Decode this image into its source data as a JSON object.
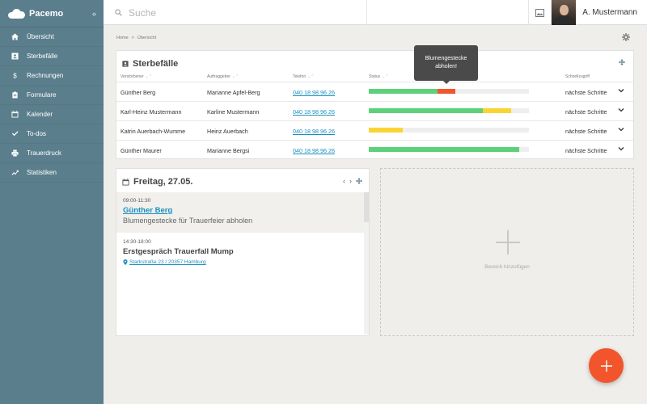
{
  "app": {
    "name": "Pacemo",
    "collapse_icon": "‹›"
  },
  "sidebar": {
    "items": [
      {
        "label": "Übersicht",
        "icon": "home-icon"
      },
      {
        "label": "Sterbefälle",
        "icon": "contact-card-icon"
      },
      {
        "label": "Rechnungen",
        "icon": "dollar-icon"
      },
      {
        "label": "Formulare",
        "icon": "clipboard-icon"
      },
      {
        "label": "Kalender",
        "icon": "calendar-icon"
      },
      {
        "label": "To-dos",
        "icon": "check-icon"
      },
      {
        "label": "Trauerdruck",
        "icon": "printer-icon"
      },
      {
        "label": "Statistiken",
        "icon": "trend-icon"
      }
    ]
  },
  "header": {
    "search_placeholder": "Suche",
    "user_name": "A. Mustermann"
  },
  "breadcrumb": {
    "home": "Home",
    "separator": ">",
    "current": "Übersicht"
  },
  "deaths": {
    "title": "Sterbefälle",
    "columns": {
      "deceased": "Verstorbener",
      "client": "Auftraggeber",
      "phone": "Telefon",
      "status": "Status",
      "quick": "Schnellzugriff"
    },
    "sort_mark": "⌄⌃",
    "rows": [
      {
        "deceased": "Günther Berg",
        "client": "Marianne Apfel-Berg",
        "phone": "040 18 98 96 26",
        "status_green": 0.43,
        "status_yellow": 0,
        "status_red": 0.11,
        "quick": "nächste Schritte"
      },
      {
        "deceased": "Karl-Heinz Mustermann",
        "client": "Karline Mustermann",
        "phone": "040 18 98 96 26",
        "status_green": 0.71,
        "status_yellow": 0.18,
        "status_red": 0,
        "quick": "nächste Schritte"
      },
      {
        "deceased": "Katrin Auerbach-Wumme",
        "client": "Heinz Auerbach",
        "phone": "040 18 98 96 26",
        "status_green": 0,
        "status_yellow": 0.21,
        "status_red": 0,
        "quick": "nächste Schritte"
      },
      {
        "deceased": "Günther Maurer",
        "client": "Marianne Bergsi",
        "phone": "040 18 98 96 26",
        "status_green": 0.94,
        "status_yellow": 0,
        "status_red": 0,
        "quick": "nächste Schritte"
      }
    ],
    "tooltip": {
      "line1": "Blumengestecke",
      "line2": "abholen!"
    },
    "colors": {
      "green": "#5ed07a",
      "yellow": "#fad434",
      "red": "#f2552c"
    }
  },
  "calendar": {
    "title": "Freitag, 27.05.",
    "prev": "‹",
    "next": "›",
    "events": [
      {
        "time": "09:00-11:30",
        "name": "Günther Berg",
        "detail": "Blumengestecke für Trauerfeier abholen"
      },
      {
        "time": "14:30-18:00",
        "name": "Erstgespräch Trauerfall Mump",
        "address": "Starkstraße 23 / 20357 Hamburg"
      }
    ]
  },
  "add_area": {
    "label": "Bereich hinzufügen"
  },
  "fab": {
    "icon": "plus-icon",
    "color": "#f2552c"
  }
}
